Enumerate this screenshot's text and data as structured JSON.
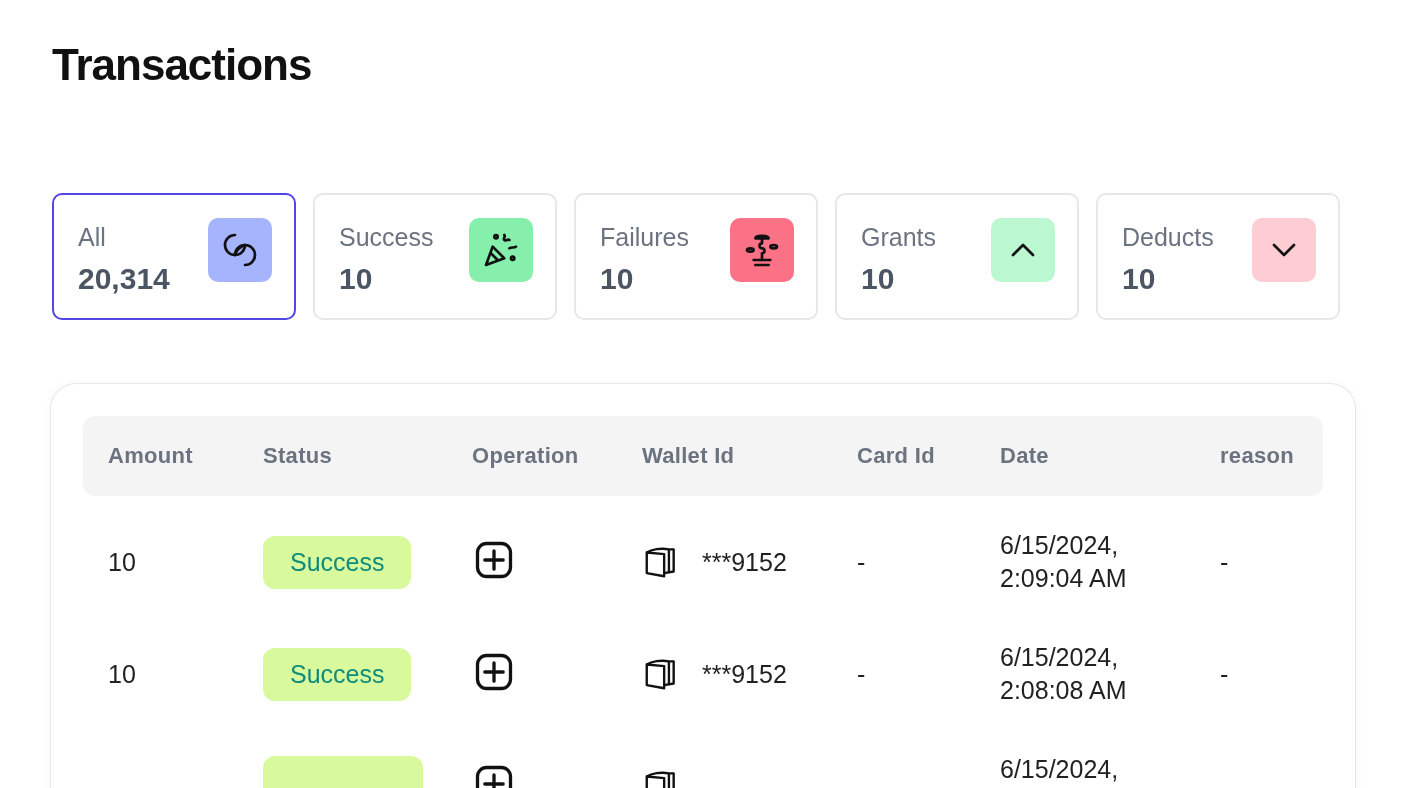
{
  "page": {
    "title": "Transactions"
  },
  "summary_cards": [
    {
      "label": "All",
      "value": "20,314",
      "kind": "all",
      "color": "#a5b4fc",
      "selected": true
    },
    {
      "label": "Success",
      "value": "10",
      "kind": "success",
      "color": "#86efac",
      "selected": false
    },
    {
      "label": "Failures",
      "value": "10",
      "kind": "failure",
      "color": "#fb7185",
      "selected": false
    },
    {
      "label": "Grants",
      "value": "10",
      "kind": "grant",
      "color": "#bbf7d0",
      "selected": false
    },
    {
      "label": "Deducts",
      "value": "10",
      "kind": "deduct",
      "color": "#fecdd3",
      "selected": false
    }
  ],
  "table": {
    "columns": [
      "Amount",
      "Status",
      "Operation",
      "Wallet Id",
      "Card Id",
      "Date",
      "reason"
    ],
    "rows": [
      {
        "amount": "10",
        "status": {
          "text": "Success",
          "kind": "success"
        },
        "operation": {
          "kind": "grant"
        },
        "wallet_id": "***9152",
        "card_id": "-",
        "date": [
          "6/15/2024,",
          "2:09:04 AM"
        ],
        "reason": "-"
      },
      {
        "amount": "10",
        "status": {
          "text": "Success",
          "kind": "success"
        },
        "operation": {
          "kind": "grant"
        },
        "wallet_id": "***9152",
        "card_id": "-",
        "date": [
          "6/15/2024,",
          "2:08:08 AM"
        ],
        "reason": "-"
      },
      {
        "status": {
          "kind": "success"
        },
        "operation": {
          "kind": "grant"
        },
        "date": [
          "6/15/2024,"
        ]
      }
    ]
  }
}
